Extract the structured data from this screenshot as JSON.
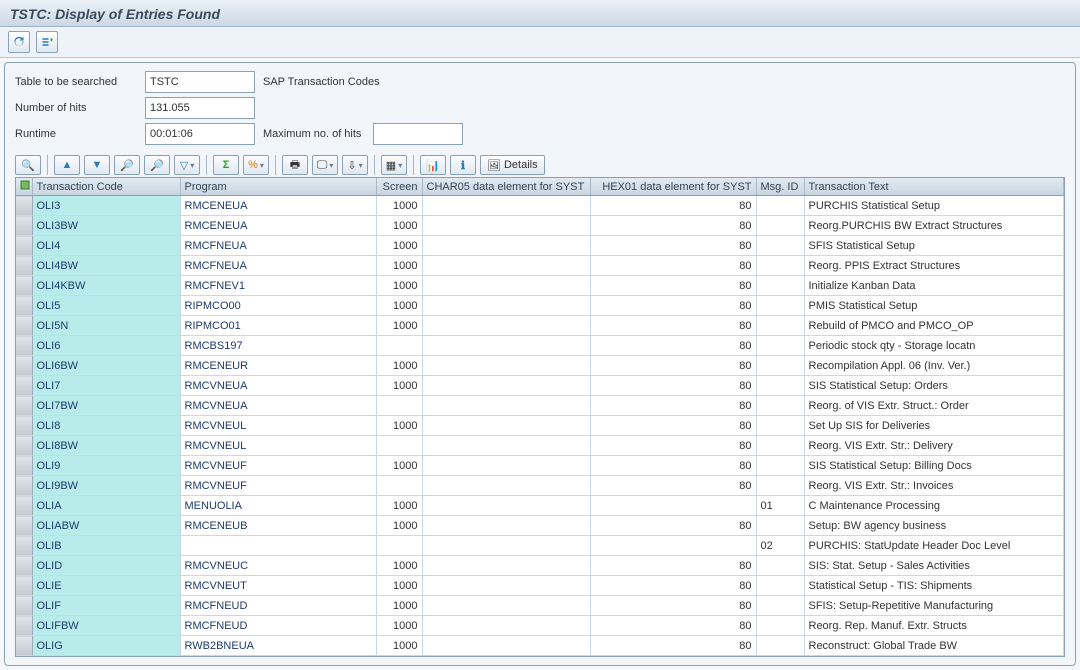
{
  "title": "TSTC: Display of Entries Found",
  "filter": {
    "table_label": "Table to be searched",
    "table_value": "TSTC",
    "table_desc": "SAP Transaction Codes",
    "hits_label": "Number of hits",
    "hits_value": "131.055",
    "runtime_label": "Runtime",
    "runtime_value": "00:01:06",
    "maxhits_label": "Maximum no. of hits",
    "maxhits_value": ""
  },
  "cols": {
    "tcode": "Transaction Code",
    "program": "Program",
    "screen": "Screen",
    "char05": "CHAR05 data element for SYST",
    "hex01": "HEX01 data element for SYST",
    "msgid": "Msg. ID",
    "ttext": "Transaction Text"
  },
  "details_label": "Details",
  "rows": [
    {
      "tcode": "OLI3",
      "program": "RMCENEUA",
      "screen": "1000",
      "char05": "",
      "hex01": "80",
      "msgid": "",
      "ttext": "PURCHIS Statistical Setup"
    },
    {
      "tcode": "OLI3BW",
      "program": "RMCENEUA",
      "screen": "1000",
      "char05": "",
      "hex01": "80",
      "msgid": "",
      "ttext": "Reorg.PURCHIS BW Extract Structures"
    },
    {
      "tcode": "OLI4",
      "program": "RMCFNEUA",
      "screen": "1000",
      "char05": "",
      "hex01": "80",
      "msgid": "",
      "ttext": "SFIS Statistical Setup"
    },
    {
      "tcode": "OLI4BW",
      "program": "RMCFNEUA",
      "screen": "1000",
      "char05": "",
      "hex01": "80",
      "msgid": "",
      "ttext": "Reorg. PPIS Extract Structures"
    },
    {
      "tcode": "OLI4KBW",
      "program": "RMCFNEV1",
      "screen": "1000",
      "char05": "",
      "hex01": "80",
      "msgid": "",
      "ttext": "Initialize Kanban Data"
    },
    {
      "tcode": "OLI5",
      "program": "RIPMCO00",
      "screen": "1000",
      "char05": "",
      "hex01": "80",
      "msgid": "",
      "ttext": "PMIS Statistical Setup"
    },
    {
      "tcode": "OLI5N",
      "program": "RIPMCO01",
      "screen": "1000",
      "char05": "",
      "hex01": "80",
      "msgid": "",
      "ttext": "Rebuild of PMCO and PMCO_OP"
    },
    {
      "tcode": "OLI6",
      "program": "RMCBS197",
      "screen": "",
      "char05": "",
      "hex01": "80",
      "msgid": "",
      "ttext": "Periodic stock qty - Storage locatn"
    },
    {
      "tcode": "OLI6BW",
      "program": "RMCENEUR",
      "screen": "1000",
      "char05": "",
      "hex01": "80",
      "msgid": "",
      "ttext": "Recompilation Appl. 06 (Inv. Ver.)"
    },
    {
      "tcode": "OLI7",
      "program": "RMCVNEUA",
      "screen": "1000",
      "char05": "",
      "hex01": "80",
      "msgid": "",
      "ttext": "SIS Statistical Setup: Orders"
    },
    {
      "tcode": "OLI7BW",
      "program": "RMCVNEUA",
      "screen": "",
      "char05": "",
      "hex01": "80",
      "msgid": "",
      "ttext": "Reorg. of VIS Extr. Struct.: Order"
    },
    {
      "tcode": "OLI8",
      "program": "RMCVNEUL",
      "screen": "1000",
      "char05": "",
      "hex01": "80",
      "msgid": "",
      "ttext": "Set Up SIS for Deliveries"
    },
    {
      "tcode": "OLI8BW",
      "program": "RMCVNEUL",
      "screen": "",
      "char05": "",
      "hex01": "80",
      "msgid": "",
      "ttext": "Reorg. VIS Extr. Str.: Delivery"
    },
    {
      "tcode": "OLI9",
      "program": "RMCVNEUF",
      "screen": "1000",
      "char05": "",
      "hex01": "80",
      "msgid": "",
      "ttext": "SIS Statistical Setup: Billing Docs"
    },
    {
      "tcode": "OLI9BW",
      "program": "RMCVNEUF",
      "screen": "",
      "char05": "",
      "hex01": "80",
      "msgid": "",
      "ttext": "Reorg. VIS Extr. Str.: Invoices"
    },
    {
      "tcode": "OLIA",
      "program": "MENUOLIA",
      "screen": "1000",
      "char05": "",
      "hex01": "",
      "msgid": "01",
      "ttext": "C Maintenance Processing"
    },
    {
      "tcode": "OLIABW",
      "program": "RMCENEUB",
      "screen": "1000",
      "char05": "",
      "hex01": "80",
      "msgid": "",
      "ttext": "Setup: BW agency business"
    },
    {
      "tcode": "OLIB",
      "program": "",
      "screen": "",
      "char05": "",
      "hex01": "",
      "msgid": "02",
      "ttext": "PURCHIS: StatUpdate Header Doc Level"
    },
    {
      "tcode": "OLID",
      "program": "RMCVNEUC",
      "screen": "1000",
      "char05": "",
      "hex01": "80",
      "msgid": "",
      "ttext": "SIS: Stat. Setup - Sales Activities"
    },
    {
      "tcode": "OLIE",
      "program": "RMCVNEUT",
      "screen": "1000",
      "char05": "",
      "hex01": "80",
      "msgid": "",
      "ttext": "Statistical Setup - TIS: Shipments"
    },
    {
      "tcode": "OLIF",
      "program": "RMCFNEUD",
      "screen": "1000",
      "char05": "",
      "hex01": "80",
      "msgid": "",
      "ttext": "SFIS: Setup-Repetitive Manufacturing"
    },
    {
      "tcode": "OLIFBW",
      "program": "RMCFNEUD",
      "screen": "1000",
      "char05": "",
      "hex01": "80",
      "msgid": "",
      "ttext": "Reorg. Rep. Manuf. Extr. Structs"
    },
    {
      "tcode": "OLIG",
      "program": "RWB2BNEUA",
      "screen": "1000",
      "char05": "",
      "hex01": "80",
      "msgid": "",
      "ttext": "Reconstruct: Global Trade BW"
    }
  ]
}
